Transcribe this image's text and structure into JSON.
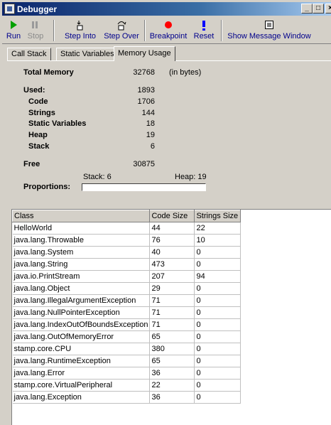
{
  "window": {
    "title": "Debugger",
    "min_glyph": "_",
    "max_glyph": "□",
    "close_glyph": "×"
  },
  "toolbar": {
    "run_label": "Run",
    "stop_label": "Stop",
    "step_into_label": "Step Into",
    "step_over_label": "Step Over",
    "breakpoint_label": "Breakpoint",
    "reset_label": "Reset",
    "show_message_window_label": "Show Message Window",
    "colors": {
      "run": "#00a000",
      "breakpoint": "#ff0000",
      "reset": "#0000ff"
    }
  },
  "tabs": [
    "Call Stack",
    "Static Variables",
    "Memory Usage"
  ],
  "active_tab": "Memory Usage",
  "memory": {
    "total_label": "Total Memory",
    "total_value": "32768",
    "units": "(in bytes)",
    "used_label": "Used:",
    "used_value": "1893",
    "code_label": "Code",
    "code_value": "1706",
    "strings_label": "Strings",
    "strings_value": "144",
    "static_label": "Static Variables",
    "static_value": "18",
    "heap_label": "Heap",
    "heap_value": "19",
    "stack_label": "Stack",
    "stack_value": "6",
    "free_label": "Free",
    "free_value": "30875",
    "proportions_label": "Proportions:",
    "stack_marker": "Stack: 6",
    "heap_marker": "Heap: 19"
  },
  "table": {
    "headers": [
      "Class",
      "Code Size",
      "Strings Size"
    ],
    "rows": [
      [
        "HelloWorld",
        "44",
        "22"
      ],
      [
        "java.lang.Throwable",
        "76",
        "10"
      ],
      [
        "java.lang.System",
        "40",
        "0"
      ],
      [
        "java.lang.String",
        "473",
        "0"
      ],
      [
        "java.io.PrintStream",
        "207",
        "94"
      ],
      [
        "java.lang.Object",
        "29",
        "0"
      ],
      [
        "java.lang.IllegalArgumentException",
        "71",
        "0"
      ],
      [
        "java.lang.NullPointerException",
        "71",
        "0"
      ],
      [
        "java.lang.IndexOutOfBoundsException",
        "71",
        "0"
      ],
      [
        "java.lang.OutOfMemoryError",
        "65",
        "0"
      ],
      [
        "stamp.core.CPU",
        "380",
        "0"
      ],
      [
        "java.lang.RuntimeException",
        "65",
        "0"
      ],
      [
        "java.lang.Error",
        "36",
        "0"
      ],
      [
        "stamp.core.VirtualPeripheral",
        "22",
        "0"
      ],
      [
        "java.lang.Exception",
        "36",
        "0"
      ]
    ]
  }
}
